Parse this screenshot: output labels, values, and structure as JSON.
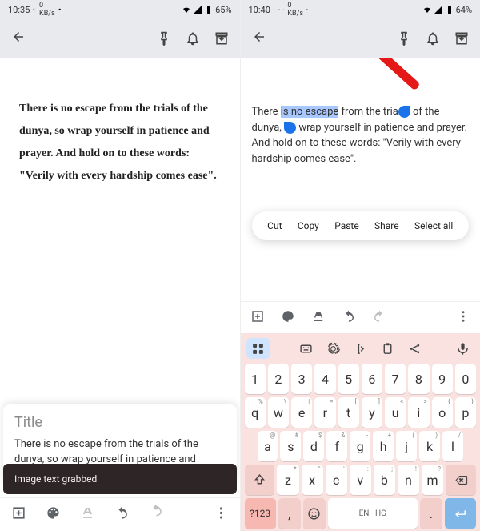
{
  "left": {
    "status": {
      "time": "10:35",
      "speed": "0 KB/s",
      "icons": "",
      "battery": "65%"
    },
    "quote": "There is no escape from the trials of the dunya, so wrap yourself in patience and prayer. And hold on to these words: \"Verily with every hardship comes ease\".",
    "sheet": {
      "title": "Title",
      "body": "There is no escape from the trials of the dunya, so wrap yourself in patience and prayer. And hold on to these words:"
    },
    "toast": "Image text grabbed"
  },
  "right": {
    "status": {
      "time": "10:40",
      "speed": "0 KB/s",
      "battery": "64%"
    },
    "context_menu": [
      "Cut",
      "Copy",
      "Paste",
      "Share",
      "Select all"
    ],
    "editor": {
      "pre": "There ",
      "highlight": "is no escape",
      "post1": " from the tria",
      "post2": " of the dunya, ",
      "post3": " wrap yourself in patience and prayer. And hold on to these words: \"Verily with every hardship comes ease\"."
    },
    "keyboard": {
      "row_num": [
        "1",
        "2",
        "3",
        "4",
        "5",
        "6",
        "7",
        "8",
        "9",
        "0"
      ],
      "row_q": [
        "q",
        "w",
        "e",
        "r",
        "t",
        "y",
        "u",
        "i",
        "o",
        "p"
      ],
      "row_q_sup": [
        "%",
        "\\",
        "|",
        "=",
        "[",
        "]",
        "<",
        ">",
        "{",
        "}"
      ],
      "row_a": [
        "a",
        "s",
        "d",
        "f",
        "g",
        "h",
        "j",
        "k",
        "l"
      ],
      "row_a_sup": [
        "@",
        "#",
        "$",
        "&",
        "-",
        "+",
        "(",
        ")",
        "/"
      ],
      "row_z": [
        "z",
        "x",
        "c",
        "v",
        "b",
        "n",
        "m"
      ],
      "row_z_sup": [
        "*",
        "\"",
        "'",
        ":",
        ";",
        "!",
        "?"
      ],
      "numkey": "?123",
      "comma": ",",
      "space": "EN · HG",
      "period": "."
    }
  }
}
